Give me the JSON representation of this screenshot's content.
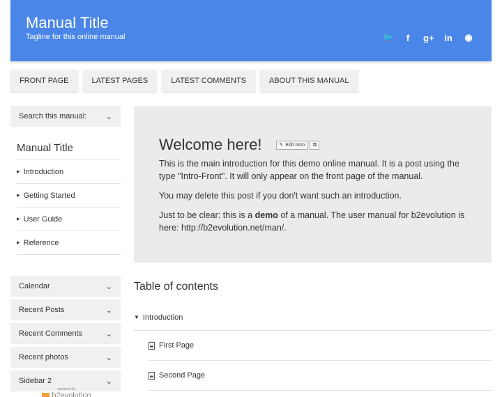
{
  "header": {
    "title": "Manual Title",
    "tagline": "Tagline for this online manual",
    "social": [
      {
        "icon": "twitter-icon",
        "glyph": "🐦"
      },
      {
        "icon": "facebook-icon",
        "glyph": "f"
      },
      {
        "icon": "googleplus-icon",
        "glyph": "g+"
      },
      {
        "icon": "linkedin-icon",
        "glyph": "in"
      },
      {
        "icon": "github-icon",
        "glyph": "◉"
      }
    ],
    "color": "#4a86e8"
  },
  "nav": {
    "tabs": [
      "FRONT PAGE",
      "LATEST PAGES",
      "LATEST COMMENTS",
      "ABOUT THIS MANUAL"
    ]
  },
  "sidebar": {
    "search_label": "Search this manual:",
    "manual_title": "Manual Title",
    "chapters": [
      "Introduction",
      "Getting Started",
      "User Guide",
      "Reference"
    ],
    "widgets": [
      "Calendar",
      "Recent Posts",
      "Recent Comments",
      "Recent photos",
      "Sidebar 2"
    ],
    "powered_small": "powered by",
    "powered_logo": "b2evolution"
  },
  "intro": {
    "heading": "Welcome here!",
    "edit_label": "Edit Intro",
    "p1": "This is the main introduction for this demo online manual. It is a post using the type \"Intro-Front\". It will only appear on the front page of the manual.",
    "p2": "You may delete this post if you don't want such an introduction.",
    "p3_a": "Just to be clear: this is a ",
    "p3_b": "demo",
    "p3_c": " of a manual. The user manual for ",
    "p3_d": "b2evolution",
    "p3_e": " is here: http://b2evolution.net/man/."
  },
  "toc": {
    "title": "Table of contents",
    "chapter": "Introduction",
    "pages": [
      "First Page",
      "Second Page"
    ]
  }
}
